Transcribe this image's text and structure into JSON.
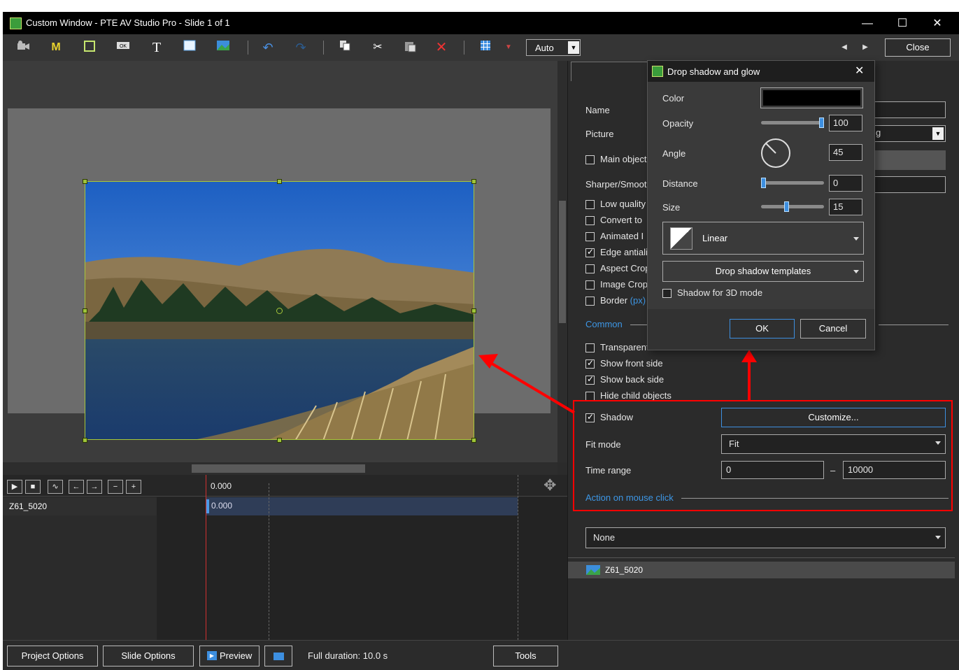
{
  "window": {
    "title": "Custom Window - PTE AV Studio Pro - Slide 1 of 1",
    "minimize": "—",
    "maximize": "☐",
    "close": "✕"
  },
  "toolbar": {
    "auto_value": "Auto",
    "close_label": "Close"
  },
  "timeline": {
    "ruler_time": "0.000",
    "track_name": "Z61_5020",
    "clip_time": "0.000"
  },
  "bottom": {
    "project_options": "Project Options",
    "slide_options": "Slide Options",
    "preview": "Preview",
    "full_duration": "Full duration: 10.0 s",
    "tools": "Tools"
  },
  "props": {
    "name_label": "Name",
    "picture_label": "Picture",
    "picture_value_partial": "g",
    "main_object": "Main object",
    "sharper": "Sharper/Smooth",
    "low_quality": "Low quality",
    "convert_to": "Convert to",
    "animated": "Animated I",
    "edge": "Edge antiali",
    "aspect_crop": "Aspect Crop",
    "image_crop": "Image Crop",
    "border": "Border",
    "border_unit": "(px)",
    "common": "Common",
    "transparent": "Transparent to selection",
    "show_front": "Show front side",
    "show_back": "Show back side",
    "hide_child": "Hide child objects",
    "shadow": "Shadow",
    "customize": "Customize...",
    "fit_mode_label": "Fit mode",
    "fit_mode_value": "Fit",
    "time_range_label": "Time range",
    "time_from": "0",
    "time_dash": "–",
    "time_to": "10000",
    "action_link": "Action on mouse click",
    "action_value": "None",
    "object_item": "Z61_5020"
  },
  "dialog": {
    "title": "Drop shadow and glow",
    "color_label": "Color",
    "color_value": "#000000",
    "opacity_label": "Opacity",
    "opacity_value": "100",
    "opacity_level": 1.0,
    "angle_label": "Angle",
    "angle_value": "45",
    "distance_label": "Distance",
    "distance_value": "0",
    "distance_level": 0.0,
    "size_label": "Size",
    "size_value": "15",
    "size_level": 0.4,
    "gradient_value": "Linear",
    "templates_label": "Drop shadow templates",
    "shadow3d_label": "Shadow for 3D mode",
    "ok_label": "OK",
    "cancel_label": "Cancel"
  },
  "colors": {
    "annotation_red": "#ff0000",
    "accent_blue": "#3d97e6",
    "selection_green": "#a8c83a"
  }
}
